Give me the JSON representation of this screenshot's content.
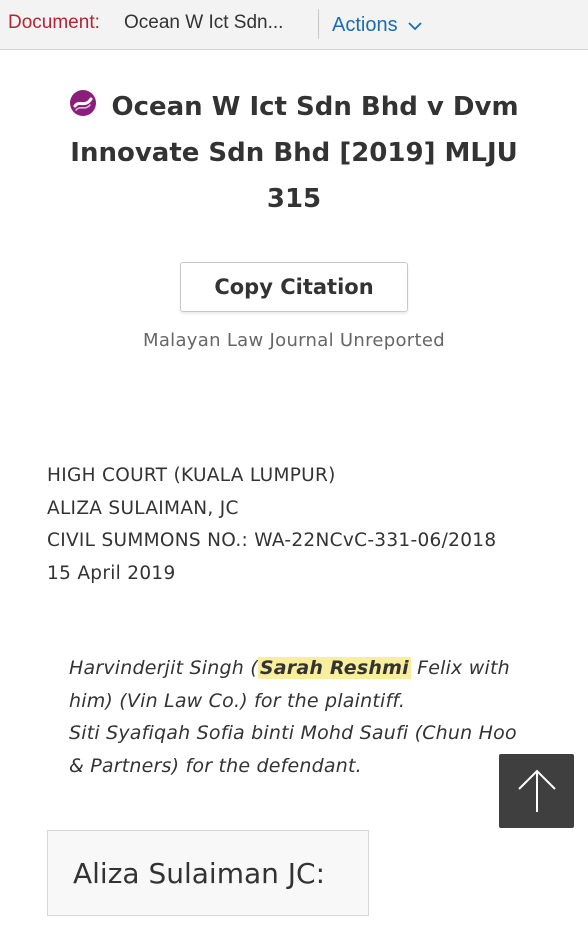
{
  "topbar": {
    "document_label": "Document:",
    "document_title": "Ocean W Ict Sdn...",
    "actions_label": "Actions"
  },
  "case": {
    "title_line1": "Ocean W Ict Sdn Bhd v Dvm",
    "title_line2": "Innovate Sdn Bhd [2019] MLJU",
    "title_line3": "315"
  },
  "copy_citation_label": "Copy Citation",
  "publication": "Malayan Law Journal Unreported",
  "court_info": {
    "court": "HIGH COURT (KUALA LUMPUR)",
    "judge": "ALIZA SULAIMAN, JC",
    "summons": "CIVIL SUMMONS NO.: WA-22NCvC-331-06/2018",
    "date": "15 April 2019"
  },
  "counsel": {
    "line1_a": "Harvinderjit Singh (",
    "line1_highlight": "Sarah Reshmi",
    "line1_b": " Felix with",
    "line2": "him) (Vin Law Co.) for the plaintiff.",
    "line3": "Siti Syafiqah Sofia binti Mohd Saufi (Chun Hoo",
    "line4": "& Partners) for the defendant."
  },
  "judge_heading": "Aliza Sulaiman JC:",
  "colors": {
    "accent_red": "#b3262f",
    "link_blue": "#1a6db4",
    "logo_purple": "#8a1e7a",
    "highlight_yellow": "#f8ee9d",
    "scroll_button_bg": "#3f3f3f"
  },
  "icons": {
    "actions_chevron": "chevron-down-icon",
    "logo": "publisher-logo-icon",
    "scroll_top": "arrow-up-icon"
  }
}
